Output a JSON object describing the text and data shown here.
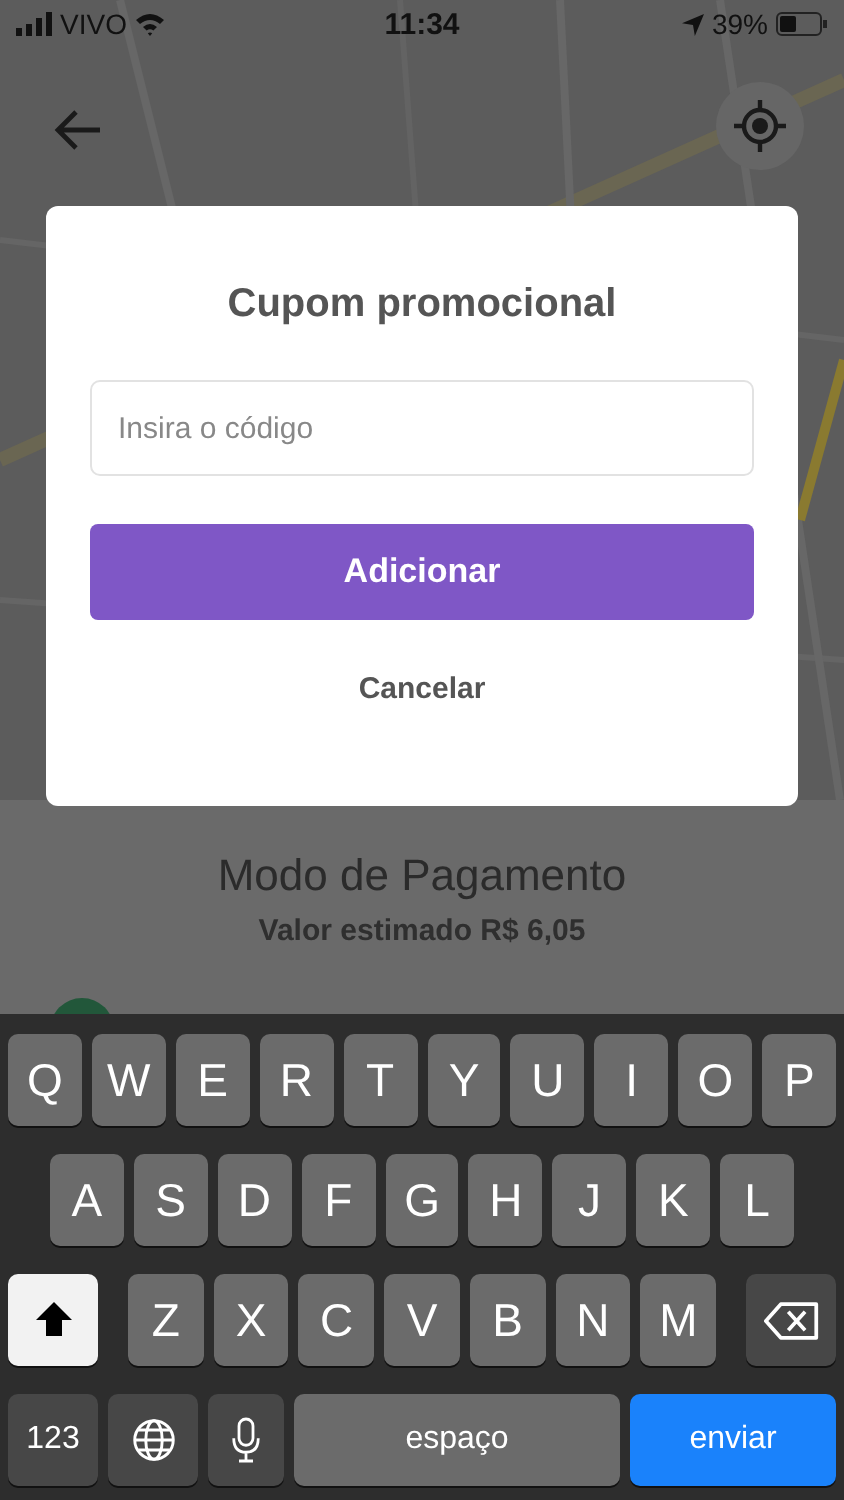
{
  "status_bar": {
    "carrier": "VIVO",
    "time": "11:34",
    "battery": "39%"
  },
  "dialog": {
    "title": "Cupom promocional",
    "code_field": {
      "placeholder": "Insira o código"
    },
    "confirm_button": "Adicionar",
    "cancel_link": "Cancelar"
  },
  "payment_sheet": {
    "title": "Modo de Pagamento",
    "estimate": "Valor estimado R$ 6,05"
  },
  "keyboard": {
    "rows": [
      {
        "keys": [
          {
            "kind": "letter",
            "label": "Q"
          },
          {
            "kind": "letter",
            "label": "W"
          },
          {
            "kind": "letter",
            "label": "E"
          },
          {
            "kind": "letter",
            "label": "R"
          },
          {
            "kind": "letter",
            "label": "T"
          },
          {
            "kind": "letter",
            "label": "Y"
          },
          {
            "kind": "letter",
            "label": "U"
          },
          {
            "kind": "letter",
            "label": "I"
          },
          {
            "kind": "letter",
            "label": "O"
          },
          {
            "kind": "letter",
            "label": "P"
          }
        ]
      },
      {
        "keys": [
          {
            "kind": "letter",
            "label": "A"
          },
          {
            "kind": "letter",
            "label": "S"
          },
          {
            "kind": "letter",
            "label": "D"
          },
          {
            "kind": "letter",
            "label": "F"
          },
          {
            "kind": "letter",
            "label": "G"
          },
          {
            "kind": "letter",
            "label": "H"
          },
          {
            "kind": "letter",
            "label": "J"
          },
          {
            "kind": "letter",
            "label": "K"
          },
          {
            "kind": "letter",
            "label": "L"
          }
        ]
      },
      {
        "keys": [
          {
            "kind": "shift",
            "on": true
          },
          {
            "kind": "letter",
            "label": "Z"
          },
          {
            "kind": "letter",
            "label": "X"
          },
          {
            "kind": "letter",
            "label": "C"
          },
          {
            "kind": "letter",
            "label": "V"
          },
          {
            "kind": "letter",
            "label": "B"
          },
          {
            "kind": "letter",
            "label": "N"
          },
          {
            "kind": "letter",
            "label": "M"
          },
          {
            "kind": "backspace"
          }
        ]
      },
      {
        "keys": [
          {
            "kind": "mode",
            "label": "123"
          },
          {
            "kind": "globe"
          },
          {
            "kind": "mic"
          },
          {
            "kind": "space",
            "label": "espaço"
          },
          {
            "kind": "return",
            "label": "enviar"
          }
        ]
      }
    ]
  }
}
